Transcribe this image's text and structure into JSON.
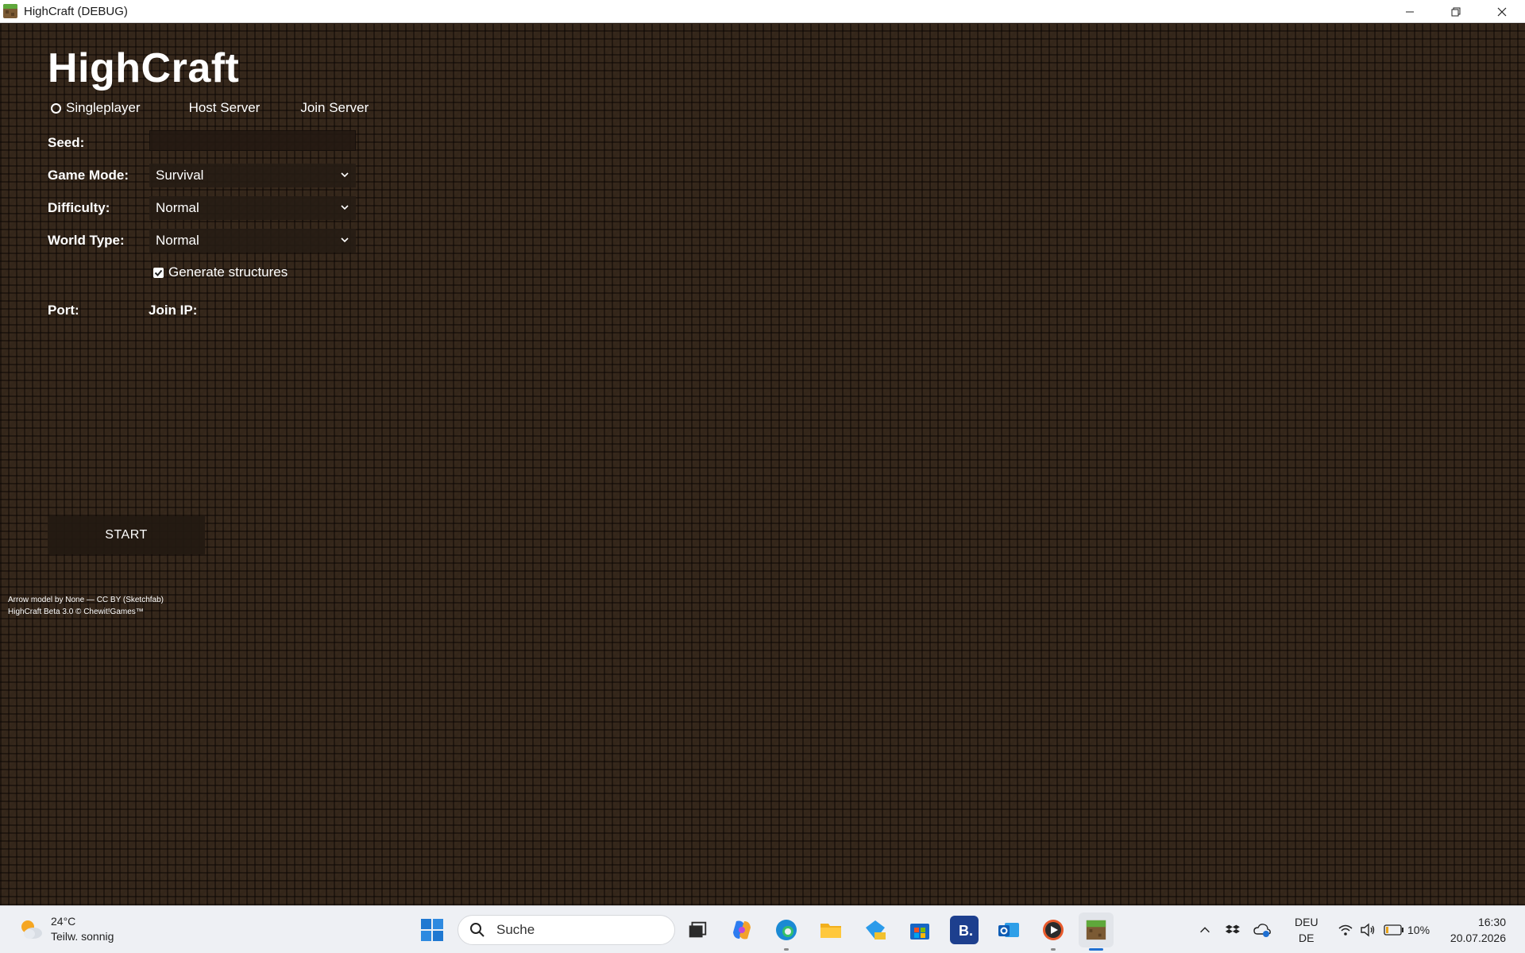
{
  "window": {
    "title": "HighCraft (DEBUG)"
  },
  "game": {
    "title": "HighCraft",
    "modes": [
      {
        "label": "Singleplayer",
        "selected": true
      },
      {
        "label": "Host Server",
        "selected": false
      },
      {
        "label": "Join Server",
        "selected": false
      }
    ],
    "seed_label": "Seed:",
    "seed_value": "",
    "game_mode_label": "Game Mode:",
    "game_mode_value": "Survival",
    "difficulty_label": "Difficulty:",
    "difficulty_value": "Normal",
    "world_type_label": "World Type:",
    "world_type_value": "Normal",
    "generate_structures_label": "Generate structures",
    "generate_structures_checked": true,
    "port_label": "Port:",
    "join_ip_label": "Join IP:",
    "start_label": "START",
    "credits": [
      "Arrow model by None — CC BY (Sketchfab)",
      "HighCraft Beta 3.0 © Chewit!Games™"
    ]
  },
  "taskbar": {
    "weather_temp": "24°C",
    "weather_desc": "Teilw. sonnig",
    "search_placeholder": "Suche",
    "lang_top": "DEU",
    "lang_bottom": "DE",
    "battery": "10%",
    "time": "16:30",
    "date": "20.07.2026",
    "icons": [
      "windows-start-icon",
      "task-view-icon",
      "copilot-icon",
      "edge-icon",
      "file-explorer-icon",
      "dev-home-icon",
      "microsoft-store-icon",
      "booking-icon",
      "outlook-icon",
      "media-player-icon",
      "highcraft-icon"
    ]
  },
  "colors": {
    "background": "#2c1f15",
    "accent": "#1f6fd1"
  }
}
